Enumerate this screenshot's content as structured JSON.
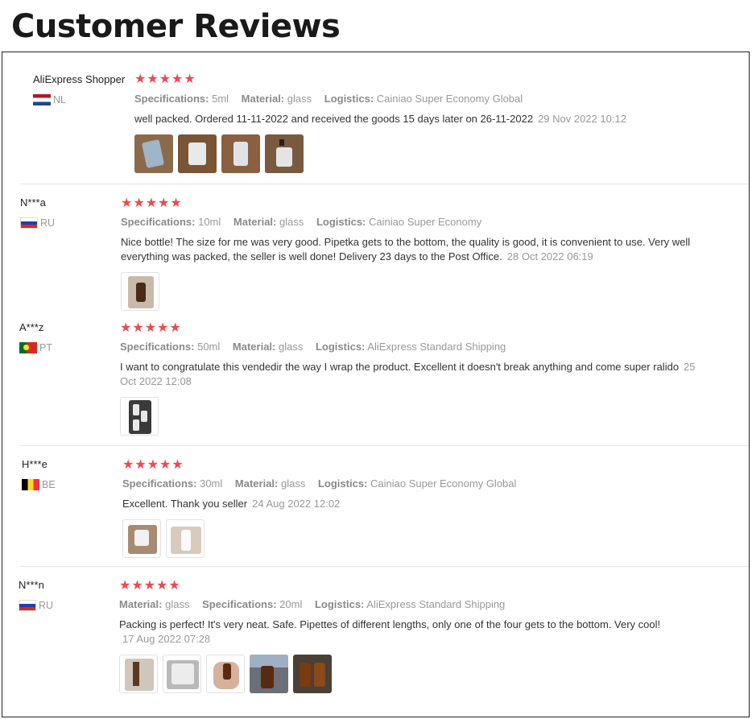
{
  "page": {
    "title": "Customer Reviews"
  },
  "labels": {
    "specifications": "Specifications:",
    "material": "Material:",
    "logistics": "Logistics:"
  },
  "reviews": [
    {
      "name": "AliExpress Shopper",
      "country": "NL",
      "rating": "★★★★★",
      "specifications": "5ml",
      "material": "glass",
      "logistics": "Cainiao Super Economy Global",
      "text": "well packed. Ordered 11-11-2022 and received the goods 15 days later on 26-11-2022",
      "date": "29 Nov 2022 10:12",
      "photos": [
        "review-photo-1",
        "review-photo-2",
        "review-photo-3",
        "review-photo-4"
      ]
    },
    {
      "name": "N***a",
      "country": "RU",
      "rating": "★★★★★",
      "specifications": "10ml",
      "material": "glass",
      "logistics": "Cainiao Super Economy",
      "text": "Nice bottle! The size for me was very good. Pipetka gets to the bottom, the quality is good, it is convenient to use. Very well everything was packed, the seller is well done! Delivery 23 days to the Post Office.",
      "date": "28 Oct 2022 06:19",
      "photos": [
        "review-photo-1"
      ]
    },
    {
      "name": "A***z",
      "country": "PT",
      "rating": "★★★★★",
      "specifications": "50ml",
      "material": "glass",
      "logistics": "AliExpress Standard Shipping",
      "text": "I want to congratulate this vendedir the way I wrap the product. Excellent it doesn't break anything and come super ralido",
      "date": "25 Oct 2022 12:08",
      "photos": [
        "review-photo-1"
      ]
    },
    {
      "name": "H***e",
      "country": "BE",
      "rating": "★★★★★",
      "specifications": "30ml",
      "material": "glass",
      "logistics": "Cainiao Super Economy Global",
      "text": "Excellent. Thank you seller",
      "date": "24 Aug 2022 12:02",
      "photos": [
        "review-photo-1",
        "review-photo-2"
      ]
    },
    {
      "name": "N***n",
      "country": "RU",
      "rating": "★★★★★",
      "specifications": "20ml",
      "material": "glass",
      "logistics": "AliExpress Standard Shipping",
      "text": "Packing is perfect! It's very neat. Safe. Pipettes of different lengths, only one of the four gets to the bottom. Very cool!",
      "date": "17 Aug 2022 07:28",
      "photos": [
        "review-photo-1",
        "review-photo-2",
        "review-photo-3",
        "review-photo-4",
        "review-photo-5"
      ]
    }
  ]
}
